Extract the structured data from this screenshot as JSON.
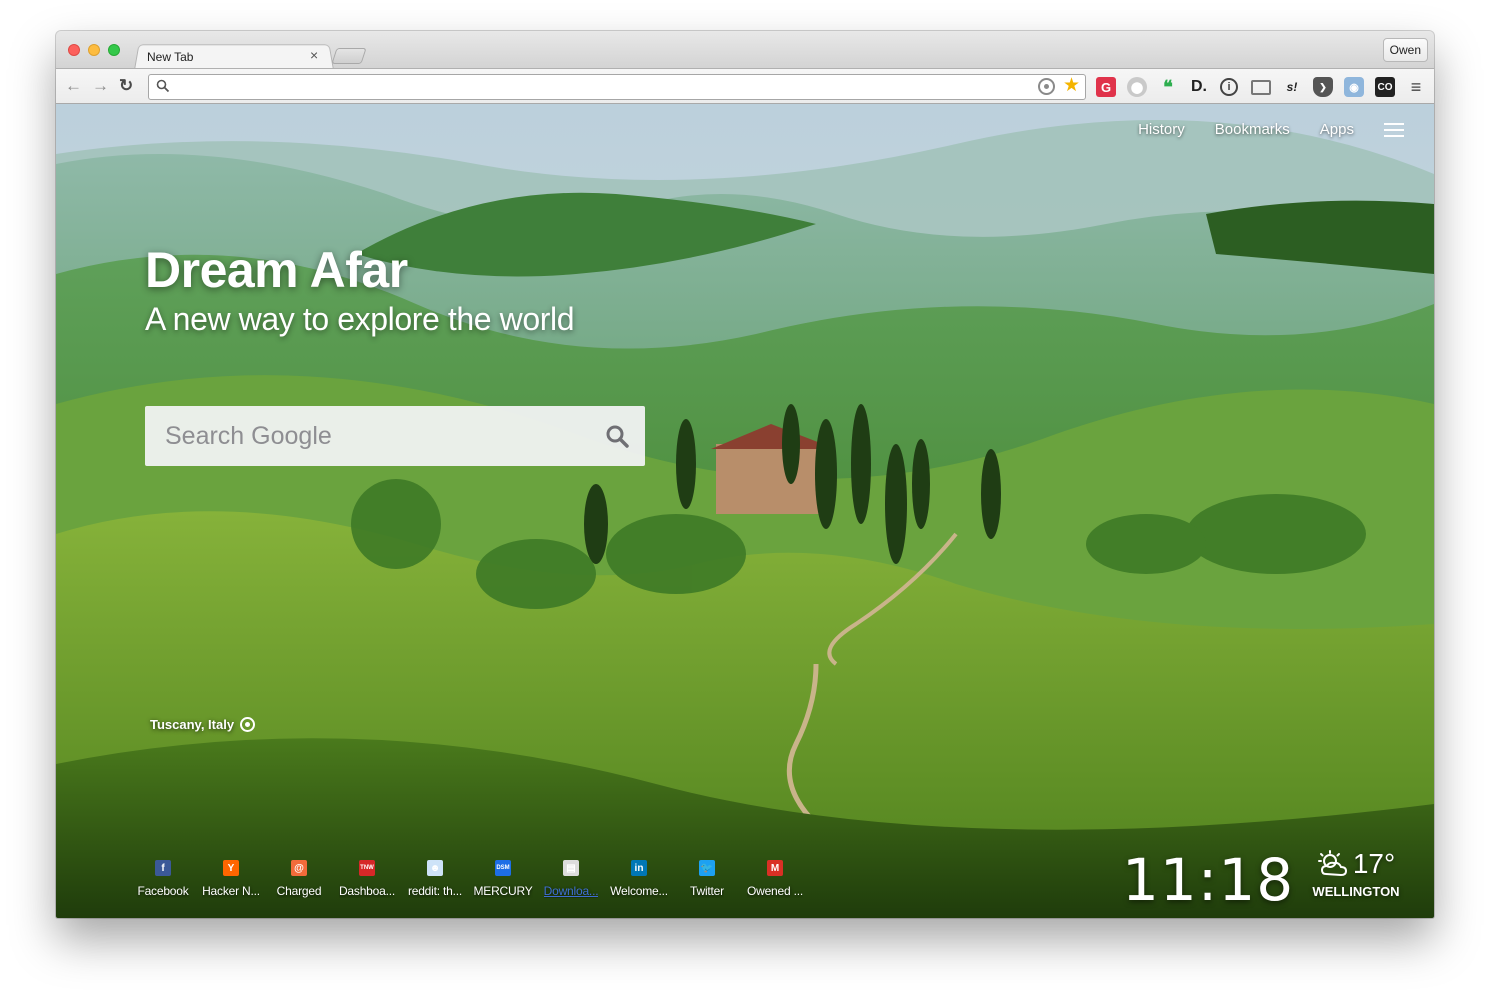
{
  "browser": {
    "tab_title": "New Tab",
    "tab_close": "×",
    "profile_name": "Owen",
    "omnibox_value": "",
    "nav": {
      "back": "←",
      "forward": "→",
      "reload": "↻"
    },
    "extensions": [
      "grammarly-icon",
      "shield-icon",
      "hangouts-icon",
      "d-icon",
      "info-icon",
      "cast-icon",
      "s-icon",
      "pocket-icon",
      "camera-icon",
      "co-icon",
      "chrome-menu-icon"
    ]
  },
  "page": {
    "nav": {
      "history": "History",
      "bookmarks": "Bookmarks",
      "apps": "Apps"
    },
    "hero": {
      "title": "Dream Afar",
      "subtitle": "A new way to explore the world"
    },
    "search": {
      "placeholder": "Search Google"
    },
    "location": "Tuscany, Italy",
    "shortcuts": [
      {
        "label": "Facebook",
        "icon": "facebook-icon",
        "color": "#3b5998",
        "glyph": "f"
      },
      {
        "label": "Hacker N...",
        "icon": "hacker-news-icon",
        "color": "#ff6600",
        "glyph": "Y"
      },
      {
        "label": "Charged",
        "icon": "charged-icon",
        "color": "#f26b3a",
        "glyph": "@"
      },
      {
        "label": "Dashboa...",
        "icon": "dashboard-icon",
        "color": "#d62828",
        "glyph": "TNW"
      },
      {
        "label": "reddit: th...",
        "icon": "reddit-icon",
        "color": "#cee3f8",
        "glyph": "☻"
      },
      {
        "label": "MERCURY",
        "icon": "mercury-icon",
        "color": "#1d6ee6",
        "glyph": "DSM"
      },
      {
        "label": "Downloa...",
        "icon": "download-icon",
        "color": "#dddddd",
        "glyph": "▤"
      },
      {
        "label": "Welcome...",
        "icon": "linkedin-icon",
        "color": "#0077b5",
        "glyph": "in"
      },
      {
        "label": "Twitter",
        "icon": "twitter-icon",
        "color": "#1da1f2",
        "glyph": "🐦"
      },
      {
        "label": "Owened ...",
        "icon": "gmail-icon",
        "color": "#d93025",
        "glyph": "M"
      }
    ],
    "clock": "11:18",
    "weather": {
      "temp": "17°",
      "city": "WELLINGTON",
      "icon": "partly-cloudy-icon"
    }
  }
}
